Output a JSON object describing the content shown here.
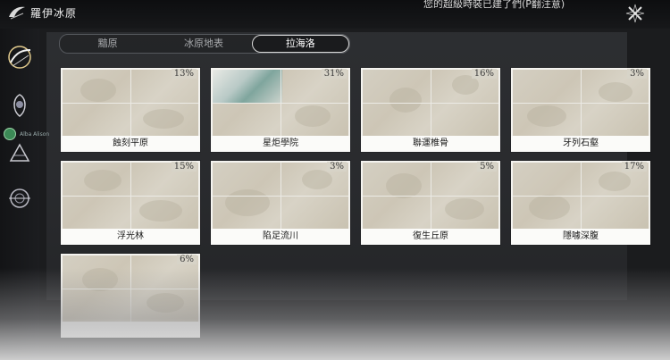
{
  "header": {
    "region_title": "羅伊冰原",
    "top_message": "您的超級時裝已建了們(P翻注意)"
  },
  "tabs": [
    {
      "label": "黯原",
      "active": false
    },
    {
      "label": "冰原地表",
      "active": false
    },
    {
      "label": "拉海洛",
      "active": true
    }
  ],
  "sidebar": {
    "avatar_name": "Alba Alison"
  },
  "areas": [
    {
      "name": "蝕刻平原",
      "progress": "13%"
    },
    {
      "name": "星炬學院",
      "progress": "31%"
    },
    {
      "name": "聯運椎骨",
      "progress": "16%"
    },
    {
      "name": "牙列石壑",
      "progress": "3%"
    },
    {
      "name": "浮光林",
      "progress": "15%"
    },
    {
      "name": "陷足流川",
      "progress": "3%"
    },
    {
      "name": "復生丘原",
      "progress": "5%"
    },
    {
      "name": "隱噱深腹",
      "progress": "17%"
    },
    {
      "name": "",
      "progress": "6%"
    }
  ],
  "colors": {
    "card_bg": "#f4f3ef",
    "accent": "#ffffff",
    "background": "#1b1c1e"
  }
}
